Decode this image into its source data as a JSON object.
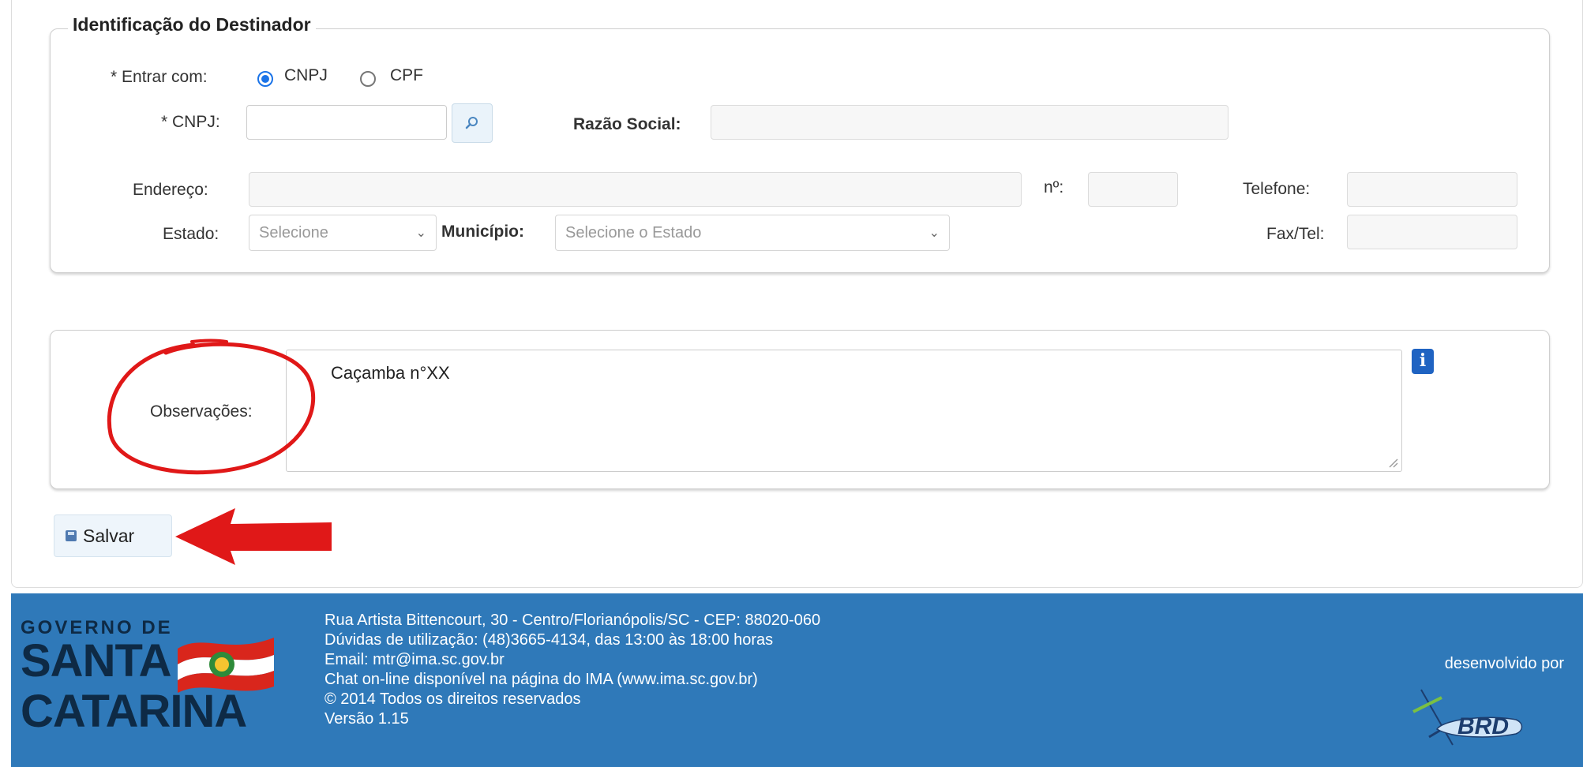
{
  "form": {
    "destinador": {
      "legend": "Identificação do Destinador",
      "entrar_com_label": "* Entrar com:",
      "radio_cnpj_label": "CNPJ",
      "radio_cpf_label": "CPF",
      "selected_option": "CNPJ",
      "cnpj_label": "* CNPJ:",
      "cnpj_value": "",
      "razao_social_label": "Razão Social:",
      "razao_social_value": "",
      "endereco_label": "Endereço:",
      "endereco_value": "",
      "numero_label": "nº:",
      "numero_value": "",
      "telefone_label": "Telefone:",
      "telefone_value": "",
      "estado_label": "Estado:",
      "estado_selected": "Selecione",
      "municipio_label": "Município:",
      "municipio_selected": "Selecione o Estado",
      "fax_label": "Fax/Tel:",
      "fax_value": ""
    },
    "observacoes": {
      "label": "Observações:",
      "value": "Caçamba n°XX"
    },
    "save_label": "Salvar"
  },
  "footer": {
    "lines": [
      "Rua Artista Bittencourt, 30 - Centro/Florianópolis/SC - CEP: 88020-060",
      "Dúvidas de utilização: (48)3665-4134, das 13:00 às 18:00 horas",
      "Email: mtr@ima.sc.gov.br",
      "Chat on-line disponível na página do IMA (www.ima.sc.gov.br)",
      "© 2014 Todos os direitos reservados",
      "Versão 1.15"
    ],
    "logo_text": [
      "GOVERNO DE",
      "SANTA",
      "CATARINA"
    ],
    "developed_by": "desenvolvido por",
    "developer_logo": "BRD"
  },
  "colors": {
    "footer_bg": "#2f79b9",
    "annotation_red": "#e01818",
    "radio_accent": "#1a73e8",
    "info_icon": "#1f63c2"
  }
}
